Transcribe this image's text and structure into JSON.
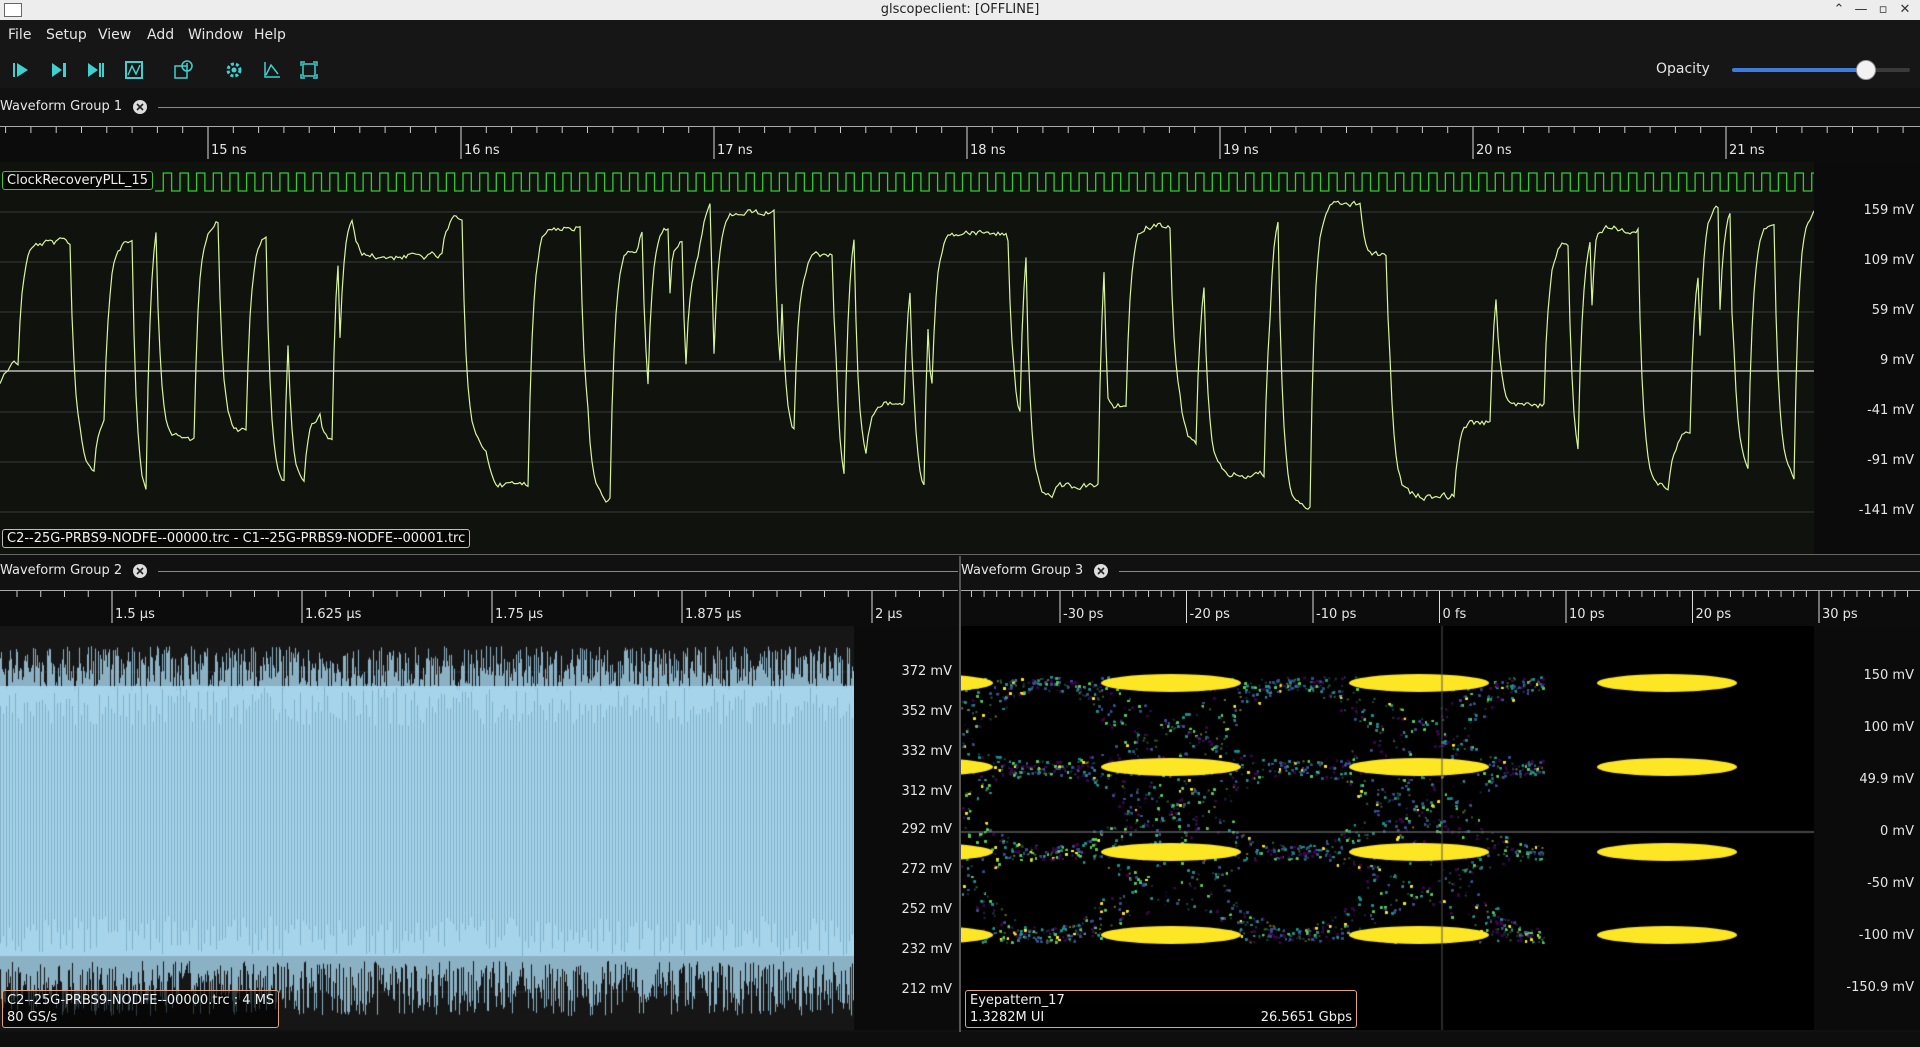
{
  "window": {
    "title": "glscopeclient: [OFFLINE]"
  },
  "menu": [
    "File",
    "Setup",
    "View",
    "Add",
    "Window",
    "Help"
  ],
  "toolbar": {
    "buttons": [
      "start-trigger",
      "single-trigger",
      "force-trigger",
      "stop-trigger",
      "history",
      "settings",
      "measurements",
      "fullscreen"
    ],
    "opacity_label": "Opacity",
    "opacity_value": 0.75
  },
  "groups": [
    {
      "title": "Waveform Group 1",
      "time_ticks": [
        "15 ns",
        "16 ns",
        "17 ns",
        "18 ns",
        "19 ns",
        "20 ns",
        "21 ns"
      ],
      "clock_label": "ClockRecoveryPLL_15",
      "v_labels": [
        "159 mV",
        "109 mV",
        "59 mV",
        "9 mV",
        "-41 mV",
        "-91 mV",
        "-141 mV"
      ],
      "channel_label": "C2--25G-PRBS9-NODFE--00000.trc - C1--25G-PRBS9-NODFE--00001.trc",
      "trace_color": "#d9f59a",
      "clock_color": "#33cc33"
    },
    {
      "title": "Waveform Group 2",
      "time_ticks": [
        "1.5 µs",
        "1.625 µs",
        "1.75 µs",
        "1.875 µs",
        "2 µs"
      ],
      "v_labels": [
        "372 mV",
        "352 mV",
        "332 mV",
        "312 mV",
        "292 mV",
        "272 mV",
        "252 mV",
        "232 mV",
        "212 mV"
      ],
      "channel_label_line1": "C2--25G-PRBS9-NODFE--00000.trc : 4 MS",
      "channel_label_line2": "80 GS/s",
      "trace_color": "#a8d8f0"
    },
    {
      "title": "Waveform Group 3",
      "time_ticks": [
        "-30 ps",
        "-20 ps",
        "-10 ps",
        "0 fs",
        "10 ps",
        "20 ps",
        "30 ps"
      ],
      "v_labels": [
        "150 mV",
        "100 mV",
        "49.9 mV",
        "0 mV",
        "-50 mV",
        "-100 mV",
        "-150.9 mV"
      ],
      "eye_name": "Eyepattern_17",
      "eye_ui": "1.3282M UI",
      "eye_rate": "26.5651 Gbps"
    }
  ]
}
